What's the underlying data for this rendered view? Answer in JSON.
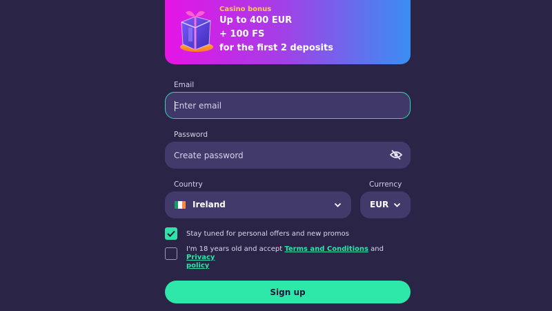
{
  "banner": {
    "kicker": "Casino bonus",
    "line1": "Up to 400 EUR",
    "line2": "+ 100 FS",
    "line3": "for the first 2 deposits",
    "icon": "gift-box-icon"
  },
  "email": {
    "label": "Email",
    "placeholder": "Enter email",
    "value": ""
  },
  "password": {
    "label": "Password",
    "placeholder": "Create password",
    "value": "",
    "toggle_icon": "eye-off-icon"
  },
  "country": {
    "label": "Country",
    "selected": "Ireland",
    "flag_icon": "ireland-flag-icon"
  },
  "currency": {
    "label": "Currency",
    "selected": "EUR"
  },
  "consents": {
    "promos": {
      "text": "Stay tuned for personal offers and new promos",
      "checked": true
    },
    "terms": {
      "text_before": "I'm 18 years old and accept ",
      "terms_link": "Terms and Conditions",
      "text_middle": " and ",
      "privacy_link_line1": "Privacy",
      "privacy_link_line2": "policy",
      "checked": false
    }
  },
  "signup": {
    "label": "Sign up"
  },
  "colors": {
    "background": "#2a2447",
    "field": "#423a6a",
    "accent": "#2ee8a9",
    "focus_border": "#2fd8b5",
    "kicker": "#ffd23a"
  }
}
